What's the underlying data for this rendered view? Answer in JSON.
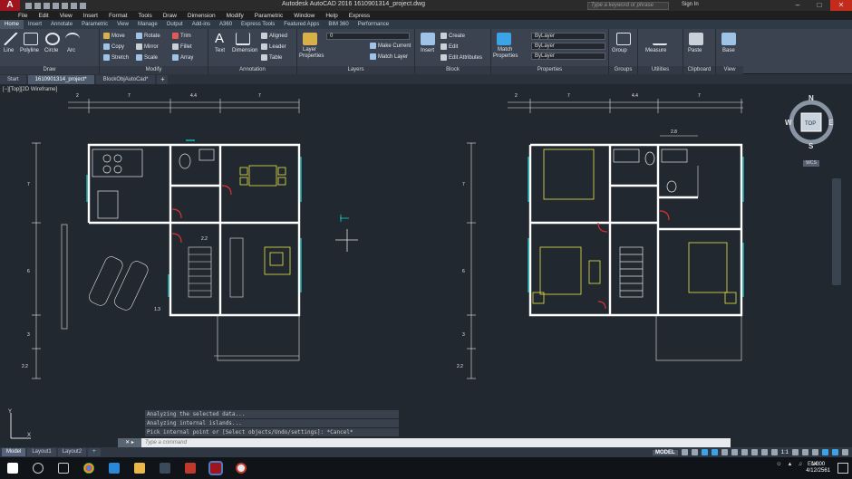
{
  "titlebar": {
    "app_logo": "A",
    "window_title": "Autodesk AutoCAD 2016    1610901314_project.dwg",
    "search_placeholder": "Type a keyword or phrase",
    "signin": "Sign In"
  },
  "menu": [
    "File",
    "Edit",
    "View",
    "Insert",
    "Format",
    "Tools",
    "Draw",
    "Dimension",
    "Modify",
    "Parametric",
    "Window",
    "Help",
    "Express"
  ],
  "ribbon_tabs": [
    "Home",
    "Insert",
    "Annotate",
    "Parametric",
    "View",
    "Manage",
    "Output",
    "Add-ins",
    "A360",
    "Express Tools",
    "Featured Apps",
    "BIM 360",
    "Performance"
  ],
  "ribbon": {
    "draw": {
      "title": "Draw",
      "line": "Line",
      "polyline": "Polyline",
      "circle": "Circle",
      "arc": "Arc"
    },
    "modify": {
      "title": "Modify",
      "move": "Move",
      "rotate": "Rotate",
      "trim": "Trim",
      "copy": "Copy",
      "mirror": "Mirror",
      "fillet": "Fillet",
      "stretch": "Stretch",
      "scale": "Scale",
      "array": "Array"
    },
    "annotation": {
      "title": "Annotation",
      "text": "Text",
      "dimension": "Dimension",
      "leader": "Leader",
      "table": "Table",
      "aligned": "Aligned"
    },
    "layers": {
      "title": "Layers",
      "properties_l1": "Layer",
      "properties_l2": "Properties",
      "current_layer": "0",
      "make_current": "Make Current",
      "match_layer": "Match Layer"
    },
    "block": {
      "title": "Block",
      "insert": "Insert",
      "create": "Create",
      "edit": "Edit",
      "edit_attributes": "Edit Attributes"
    },
    "properties": {
      "title": "Properties",
      "match_l1": "Match",
      "match_l2": "Properties",
      "bylayer1": "ByLayer",
      "bylayer2": "ByLayer",
      "bylayer3": "ByLayer"
    },
    "groups": {
      "title": "Groups",
      "group": "Group"
    },
    "utilities": {
      "title": "Utilities",
      "measure": "Measure"
    },
    "clipboard": {
      "title": "Clipboard",
      "paste": "Paste"
    },
    "view": {
      "title": "View",
      "base": "Base"
    }
  },
  "doc_tabs": [
    "Start",
    "1610901314_project*",
    "BlockObjAutoCad*"
  ],
  "viewport": {
    "label": "[−][Top][2D Wireframe]"
  },
  "viewcube": {
    "n": "N",
    "s": "S",
    "e": "E",
    "w": "W",
    "top": "TOP",
    "wcs": "WCS"
  },
  "dims": {
    "top_left": [
      "2",
      "7",
      "4.4",
      "7"
    ],
    "top_right": [
      "2",
      "7",
      "4.4",
      "7"
    ],
    "left_side": [
      "7",
      "6",
      "3",
      "2.2"
    ],
    "right_side": [
      "7",
      "6",
      "3",
      "2.2"
    ],
    "inner_22": "2.2",
    "inner_13": "1.3",
    "inner_28": "2.8"
  },
  "command": {
    "history": [
      "Analyzing the selected data...",
      "Analyzing internal islands...",
      "Pick internal point or [Select objects/Undo/settings]: *Cancel*"
    ],
    "placeholder": "Type a command"
  },
  "layout_tabs": [
    "Model",
    "Layout1",
    "Layout2"
  ],
  "status": {
    "model": "MODEL",
    "scale": "1:1"
  },
  "taskbar": {
    "lang": "ENG",
    "time": "14:00",
    "date": "4/12/2561"
  },
  "colors": {
    "accent": "#a0141e",
    "wall": "#ffffff",
    "furniture": "#e8e84a",
    "dimension": "#e6e6e6",
    "cyan": "#19d4d4",
    "red": "#e03030"
  }
}
